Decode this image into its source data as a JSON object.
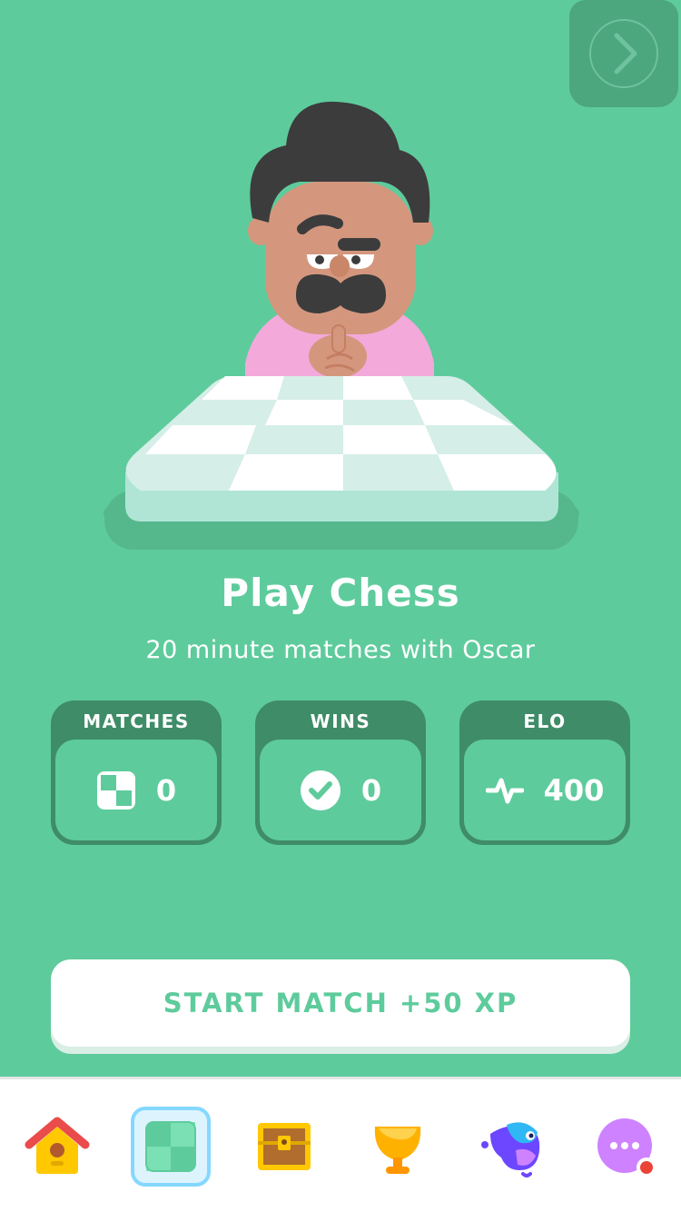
{
  "header": {
    "next_icon": "chevron-right-icon"
  },
  "hero": {
    "character": "Oscar",
    "illustration": "character-with-chessboard"
  },
  "title": "Play Chess",
  "subtitle": "20 minute matches with Oscar",
  "stats": [
    {
      "label": "MATCHES",
      "value": "0",
      "icon": "chessboard-icon"
    },
    {
      "label": "WINS",
      "value": "0",
      "icon": "check-circle-icon"
    },
    {
      "label": "ELO",
      "value": "400",
      "icon": "pulse-icon"
    }
  ],
  "start_button": {
    "label": "START MATCH +50 XP"
  },
  "tabbar": {
    "items": [
      {
        "name": "home",
        "icon": "home-icon",
        "active": false
      },
      {
        "name": "chess",
        "icon": "chessboard-tab-icon",
        "active": true
      },
      {
        "name": "chest",
        "icon": "treasure-chest-icon",
        "active": false
      },
      {
        "name": "leaderboard",
        "icon": "trophy-icon",
        "active": false
      },
      {
        "name": "character",
        "icon": "bird-character-icon",
        "active": false
      },
      {
        "name": "more",
        "icon": "more-icon",
        "active": false,
        "badge": true
      }
    ]
  },
  "colors": {
    "background": "#5ECB9C",
    "card_dark": "#3F8C68",
    "white": "#FFFFFF",
    "active_tab_border": "#84D8FF",
    "badge_red": "#EA4335"
  }
}
